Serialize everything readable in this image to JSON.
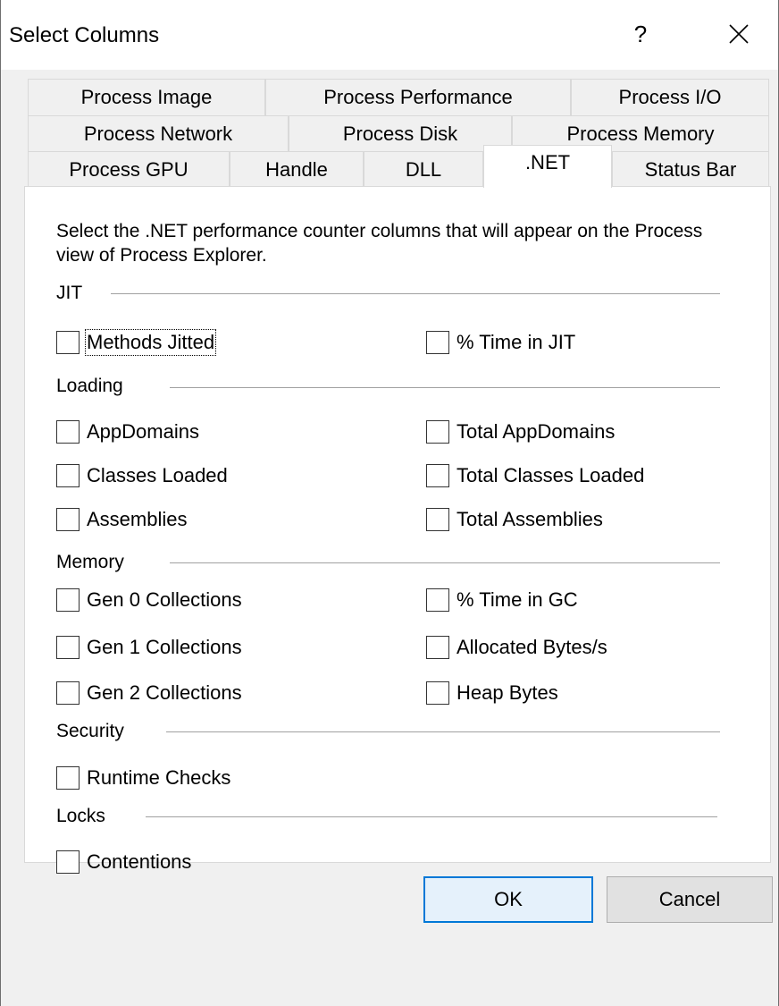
{
  "window": {
    "title": "Select Columns",
    "help_glyph": "?",
    "close_glyph": "×"
  },
  "tabs": {
    "row1": [
      "Process Image",
      "Process Performance",
      "Process I/O"
    ],
    "row2": [
      "Process Network",
      "Process Disk",
      "Process Memory"
    ],
    "row3": [
      "Process GPU",
      "Handle",
      "DLL",
      ".NET",
      "Status Bar"
    ],
    "active": ".NET"
  },
  "panel": {
    "description": "Select the .NET performance counter columns that will appear on the Process view of Process Explorer.",
    "groups": {
      "jit": {
        "label": "JIT",
        "methods_jitted": "Methods Jitted",
        "time_in_jit": "% Time in JIT"
      },
      "loading": {
        "label": "Loading",
        "appdomains": "AppDomains",
        "total_appdomains": "Total AppDomains",
        "classes_loaded": "Classes Loaded",
        "total_classes_loaded": "Total Classes Loaded",
        "assemblies": "Assemblies",
        "total_assemblies": "Total Assemblies"
      },
      "memory": {
        "label": "Memory",
        "gen0": "Gen 0 Collections",
        "time_in_gc": "% Time in GC",
        "gen1": "Gen 1 Collections",
        "allocated_bytes": "Allocated Bytes/s",
        "gen2": "Gen 2 Collections",
        "heap_bytes": "Heap Bytes"
      },
      "security": {
        "label": "Security",
        "runtime_checks": "Runtime Checks"
      },
      "locks": {
        "label": "Locks",
        "contentions": "Contentions"
      }
    }
  },
  "buttons": {
    "ok": "OK",
    "cancel": "Cancel"
  },
  "colors": {
    "accent": "#0078d7",
    "dialog_bg": "#f0f0f0",
    "panel_bg": "#ffffff"
  }
}
